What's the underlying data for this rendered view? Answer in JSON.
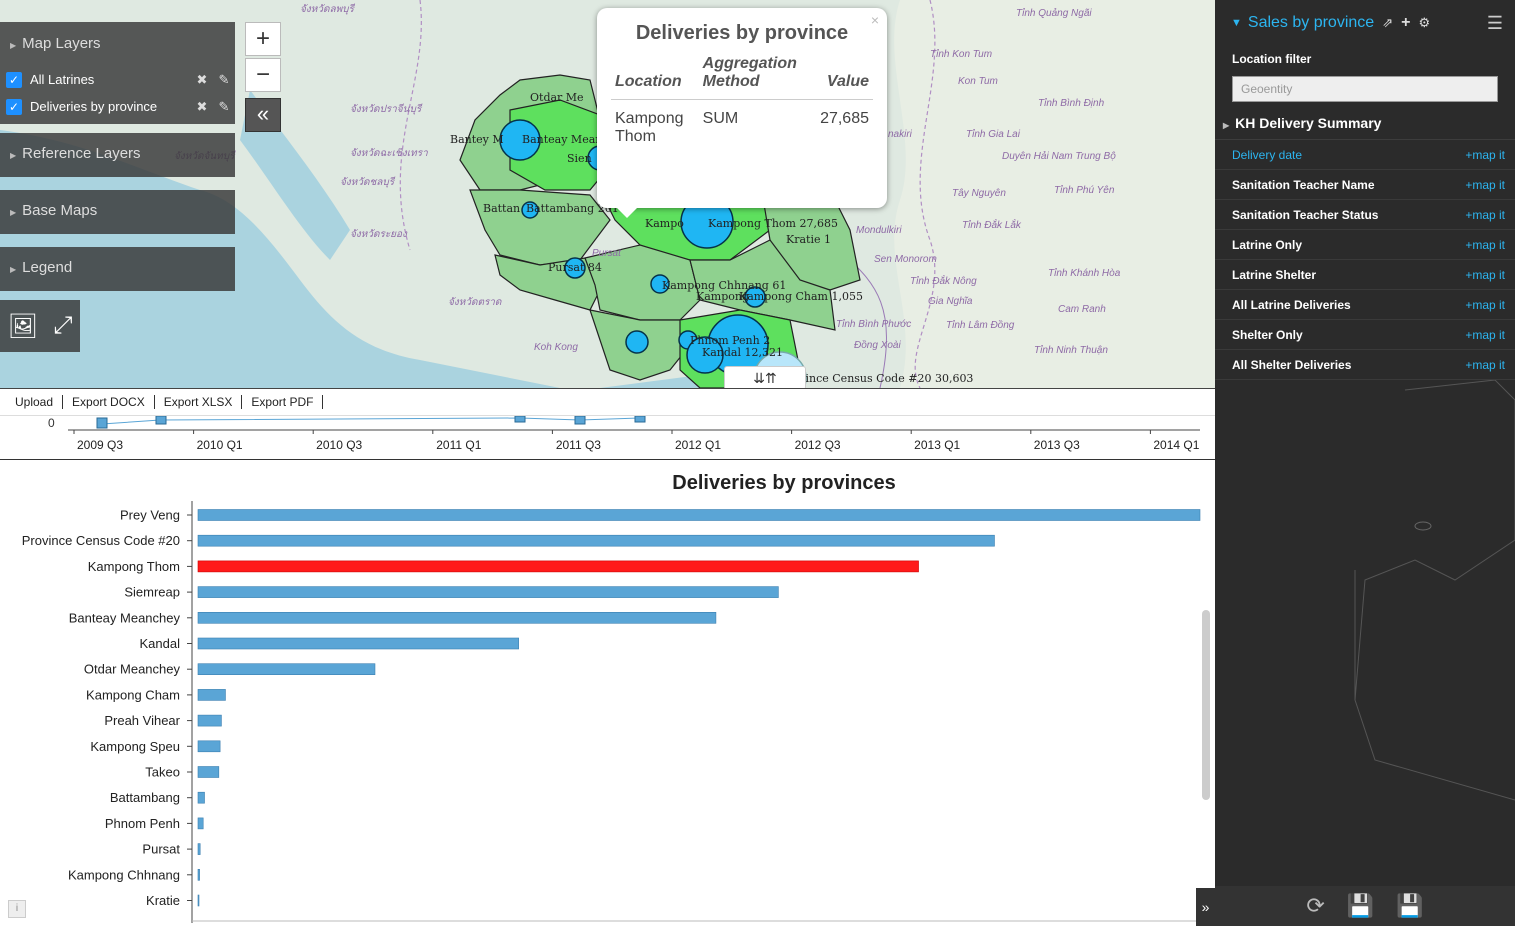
{
  "layers_panel": {
    "map_layers": "Map Layers",
    "layers": [
      {
        "label": "All Latrines"
      },
      {
        "label": "Deliveries by province"
      }
    ],
    "reference_layers": "Reference Layers",
    "base_maps": "Base Maps",
    "legend": "Legend"
  },
  "zoom": {
    "in": "+",
    "out": "−",
    "collapse": "«"
  },
  "map_labels": [
    {
      "text": "Otdar Me"
    },
    {
      "text": "Bantey M"
    },
    {
      "text": "Banteay Mean"
    },
    {
      "text": "Sien"
    },
    {
      "text": "Battan"
    },
    {
      "text": "Battambang  201"
    },
    {
      "text": "Kampo"
    },
    {
      "text": "Kampong Thom  27,685"
    },
    {
      "text": "Kratie  1"
    },
    {
      "text": "Pursat  84"
    },
    {
      "text": "Kampong Chhnang  61"
    },
    {
      "text": "Kampong Cham  1,055"
    },
    {
      "text": "Kampong"
    },
    {
      "text": "Phnom Penh  2"
    },
    {
      "text": "Kandal  12,321"
    },
    {
      "text": "Province Census Code #20  30,603"
    }
  ],
  "place_labels": [
    {
      "text": "จังหวัดลพบุรี"
    },
    {
      "text": "Tỉnh Quảng Ngãi"
    },
    {
      "text": "Tỉnh Kon Tum"
    },
    {
      "text": "Kon Tum"
    },
    {
      "text": "Tỉnh Bình Định"
    },
    {
      "text": "Tỉnh Gia Lai"
    },
    {
      "text": "Duyên Hải Nam Trung Bộ"
    },
    {
      "text": "Tây Nguyên"
    },
    {
      "text": "Tỉnh Phú Yên"
    },
    {
      "text": "Tỉnh Đắk Lắk"
    },
    {
      "text": "Mondulkiri"
    },
    {
      "text": "Sen Monorom"
    },
    {
      "text": "Tỉnh Khánh Hòa"
    },
    {
      "text": "Tỉnh Đắk Nông"
    },
    {
      "text": "Gia Nghĩa"
    },
    {
      "text": "Cam Ranh"
    },
    {
      "text": "Tỉnh Bình Phước"
    },
    {
      "text": "Tỉnh Lâm Đồng"
    },
    {
      "text": "Đồng Xoài"
    },
    {
      "text": "Tỉnh Ninh Thuận"
    },
    {
      "text": "Koh Kong"
    },
    {
      "text": "จังหวัดปราจีนบุรี"
    },
    {
      "text": "จังหวัดฉะเชิงเทรา"
    },
    {
      "text": "จังหวัดชลบุรี"
    },
    {
      "text": "จังหวัดระยอง"
    },
    {
      "text": "จังหวัดจันทบุรี"
    },
    {
      "text": "จังหวัดตราด"
    },
    {
      "text": "Pursat"
    },
    {
      "text": "nakiri"
    }
  ],
  "popup": {
    "title": "Deliveries by province",
    "col_location": "Location",
    "col_method": "Aggregation Method",
    "col_value": "Value",
    "location": "Kampong Thom",
    "method": "SUM",
    "value": "27,685",
    "close": "×"
  },
  "export_bar": {
    "items": [
      "Upload",
      "Export DOCX",
      "Export XLSX",
      "Export PDF"
    ]
  },
  "expand_toggle": "⇊⇈",
  "timeline": {
    "y_zero": "0",
    "ticks": [
      "2009 Q3",
      "2010 Q1",
      "2010 Q3",
      "2011 Q1",
      "2011 Q3",
      "2012 Q1",
      "2012 Q3",
      "2013 Q1",
      "2013 Q3",
      "2014 Q1"
    ]
  },
  "chart_data": {
    "type": "bar",
    "orientation": "horizontal",
    "title": "Deliveries by provinces",
    "categories": [
      "Prey Veng",
      "Province Census Code #20",
      "Kampong Thom",
      "Siemreap",
      "Banteay Meanchey",
      "Kandal",
      "Otdar Meanchey",
      "Kampong Cham",
      "Preah Vihear",
      "Kampong Speu",
      "Takeo",
      "Battambang",
      "Phnom Penh",
      "Pursat",
      "Kampong Chhnang",
      "Kratie"
    ],
    "values": [
      38500,
      30603,
      27685,
      22300,
      19900,
      12321,
      6800,
      1055,
      900,
      850,
      800,
      250,
      200,
      84,
      61,
      1
    ],
    "highlight": "Kampong Thom",
    "colors": {
      "bar": "#5aa5d6",
      "highlight": "#ff1a1a"
    }
  },
  "right_panel": {
    "title": "Sales by province",
    "location_filter": "Location filter",
    "geo_placeholder": "Geoentity",
    "summary": "KH Delivery Summary",
    "map_it": "+map it",
    "fields": [
      {
        "label": "Delivery date",
        "active": true
      },
      {
        "label": "Sanitation Teacher Name"
      },
      {
        "label": "Sanitation Teacher Status"
      },
      {
        "label": "Latrine Only"
      },
      {
        "label": "Latrine Shelter"
      },
      {
        "label": "All Latrine Deliveries"
      },
      {
        "label": "Shelter Only"
      },
      {
        "label": "All Shelter Deliveries"
      }
    ]
  },
  "colors": {
    "accent": "#2cb5f0",
    "panel": "#2b2b2b",
    "bubble": "#1fb6f3",
    "province": "#8fd18f",
    "province_hi": "#5ee05e"
  }
}
